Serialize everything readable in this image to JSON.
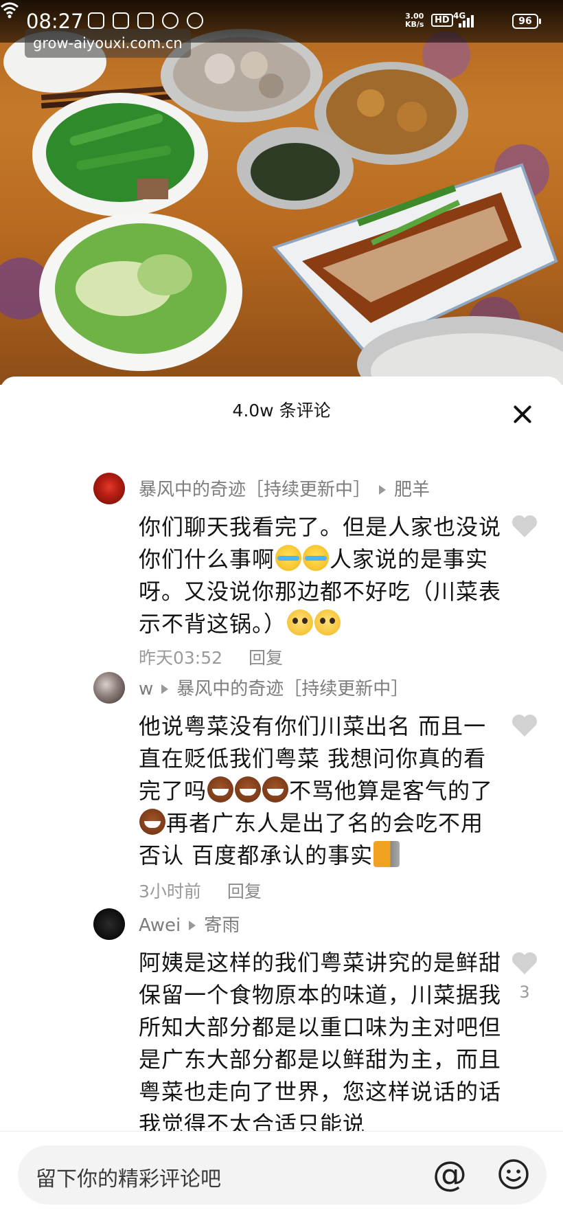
{
  "status_bar": {
    "time": "08:27",
    "net_speed_value": "3.00",
    "net_speed_unit": "KB/s",
    "hd_label": "HD",
    "signal_label": "4G",
    "battery": "96"
  },
  "watermark": "grow-aiyouxi.com.cn",
  "comments_header": {
    "title": "4.0w 条评论"
  },
  "comments": [
    {
      "author": "暴风中的奇迹［持续更新中］",
      "reply_to": "肥羊",
      "text_parts": [
        "你们聊天我看完了。但是人家也没说你们什么事啊",
        "人家说的是事实呀。又没说你那边都不好吃（川菜表示不背这锅。）"
      ],
      "time": "昨天03:52",
      "reply_label": "回复"
    },
    {
      "author": "w",
      "reply_to": "暴风中的奇迹［持续更新中］",
      "text_parts": [
        "他说粤菜没有你们川菜出名 而且一直在贬低我们粤菜 我想问你真的看完了吗",
        "不骂他算是客气的了",
        "再者广东人是出了名的会吃不用否认 百度都承认的事实"
      ],
      "time": "3小时前",
      "reply_label": "回复"
    },
    {
      "author": "Awei",
      "reply_to": "寄雨",
      "text": "阿姨是这样的我们粤菜讲究的是鲜甜保留一个食物原本的味道，川菜据我所知大部分都是以重口味为主对吧但是广东大部分都是以鲜甜为主，而且粤菜也走向了世界，您这样说话的话我觉得不太合适只能说",
      "likes": "3"
    }
  ],
  "input_bar": {
    "placeholder": "留下你的精彩评论吧",
    "mention_icon": "@"
  },
  "icons": {
    "close": "close-icon",
    "like": "heart-icon",
    "emoji": "smile-icon",
    "mention": "at-icon"
  },
  "colors": {
    "meta_text": "#9a9a9a",
    "name_text": "#7c7c7c",
    "input_bg": "#f3f3f3"
  }
}
